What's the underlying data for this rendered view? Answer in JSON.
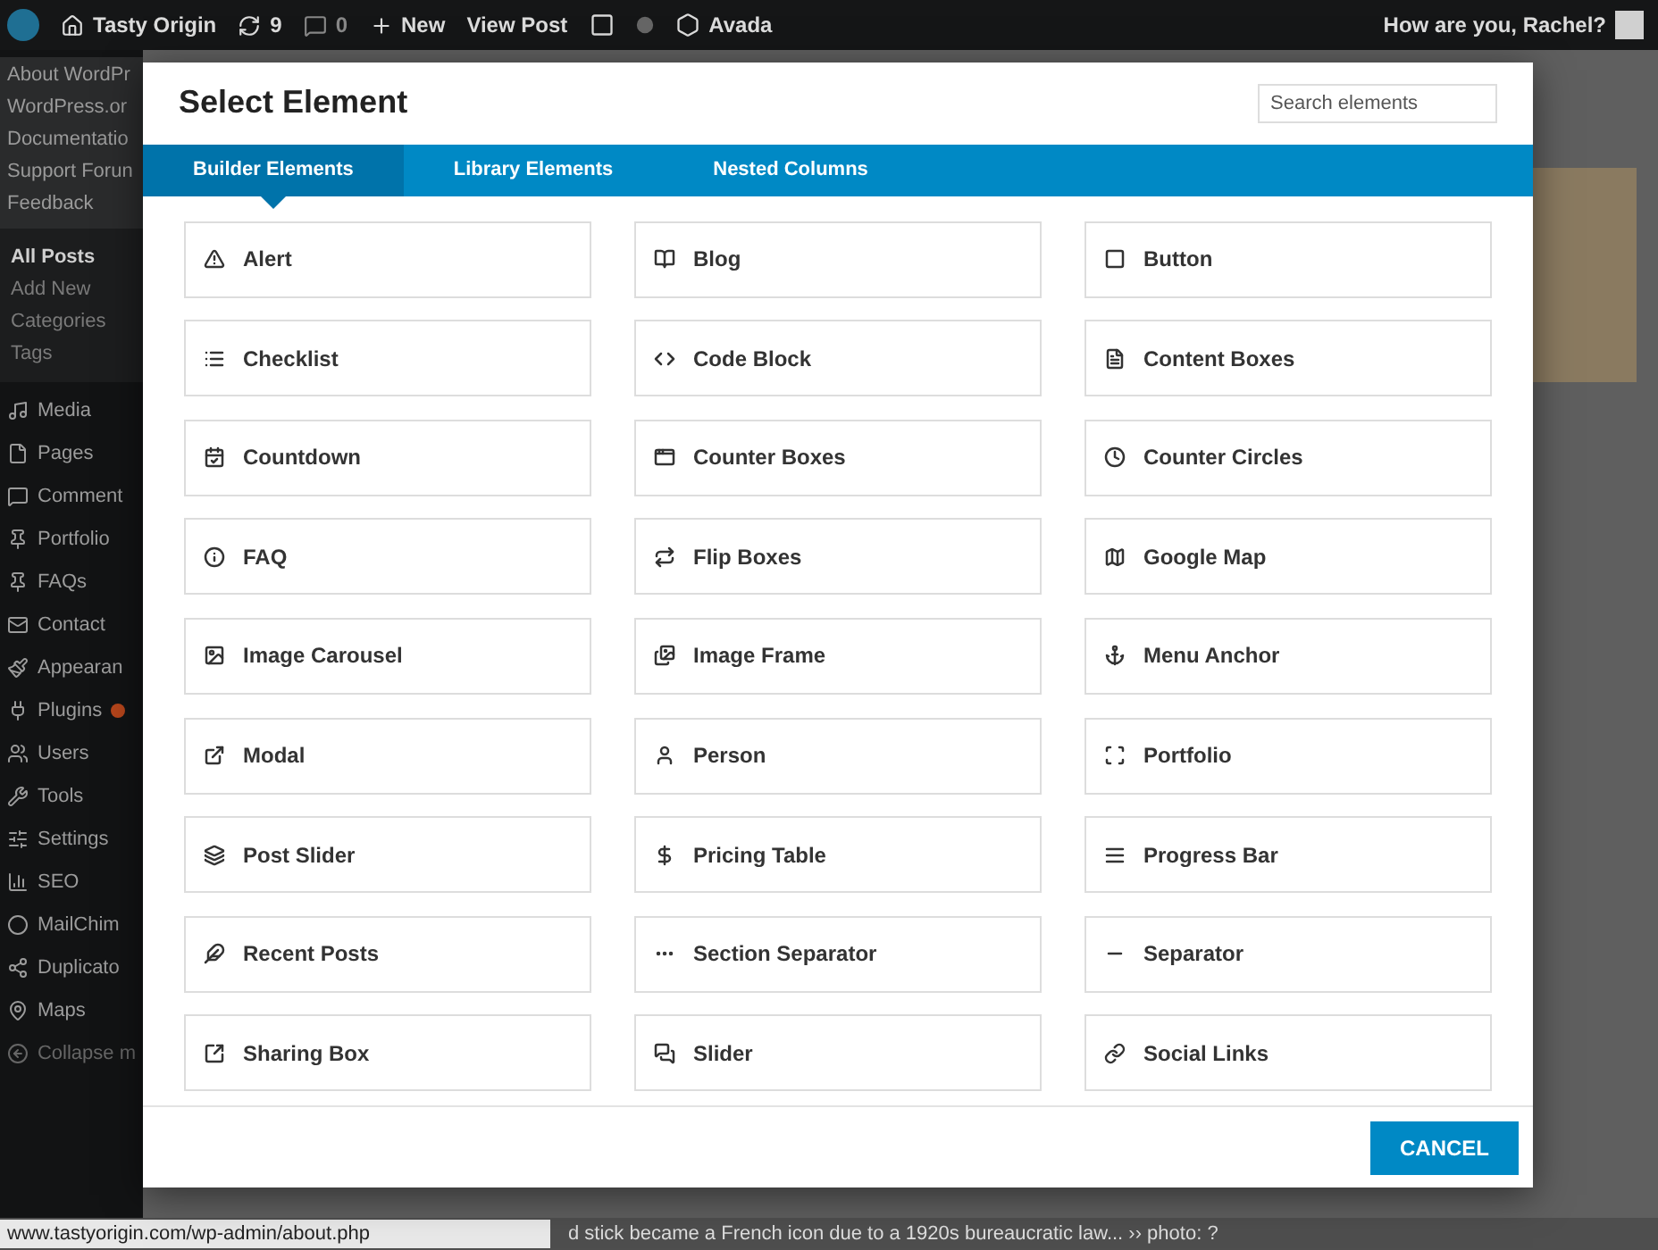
{
  "admin_bar": {
    "site": "Tasty Origin",
    "updates": "9",
    "comments": "0",
    "new": "New",
    "view_post": "View Post",
    "theme": "Avada",
    "greeting": "How are you, Rachel?"
  },
  "sidebar": {
    "flyout": [
      "About WordPr",
      "WordPress.or",
      "Documentatio",
      "Support Forun",
      "Feedback"
    ],
    "submenu": [
      {
        "label": "All Posts",
        "selected": true
      },
      {
        "label": "Add New",
        "selected": false
      },
      {
        "label": "Categories",
        "selected": false
      },
      {
        "label": "Tags",
        "selected": false
      }
    ],
    "menu": [
      {
        "label": "Media",
        "badge": false
      },
      {
        "label": "Pages",
        "badge": false
      },
      {
        "label": "Comment",
        "badge": false
      },
      {
        "label": "Portfolio",
        "badge": false
      },
      {
        "label": "FAQs",
        "badge": false
      },
      {
        "label": "Contact",
        "badge": false
      },
      {
        "label": "Appearan",
        "badge": false
      },
      {
        "label": "Plugins",
        "badge": true
      },
      {
        "label": "Users",
        "badge": false
      },
      {
        "label": "Tools",
        "badge": false
      },
      {
        "label": "Settings",
        "badge": false
      },
      {
        "label": "SEO",
        "badge": false
      },
      {
        "label": "MailChim",
        "badge": false
      },
      {
        "label": "Duplicato",
        "badge": false
      },
      {
        "label": "Maps",
        "badge": false
      }
    ],
    "collapse": "Collapse m"
  },
  "modal": {
    "title": "Select Element",
    "search": {
      "placeholder": "Search elements"
    },
    "tabs": [
      {
        "label": "Builder Elements",
        "selected": true
      },
      {
        "label": "Library Elements",
        "selected": false
      },
      {
        "label": "Nested Columns",
        "selected": false
      }
    ],
    "elements": [
      "Alert",
      "Blog",
      "Button",
      "Checklist",
      "Code Block",
      "Content Boxes",
      "Countdown",
      "Counter Boxes",
      "Counter Circles",
      "FAQ",
      "Flip Boxes",
      "Google Map",
      "Image Carousel",
      "Image Frame",
      "Menu Anchor",
      "Modal",
      "Person",
      "Portfolio",
      "Post Slider",
      "Pricing Table",
      "Progress Bar",
      "Recent Posts",
      "Section Separator",
      "Separator",
      "Sharing Box",
      "Slider",
      "Social Links"
    ],
    "cancel": "CANCEL"
  },
  "background_caption": "d stick became a French icon due to a 1920s bureaucratic law... ›› photo: ?",
  "status_url": "www.tastyorigin.com/wp-admin/about.php"
}
